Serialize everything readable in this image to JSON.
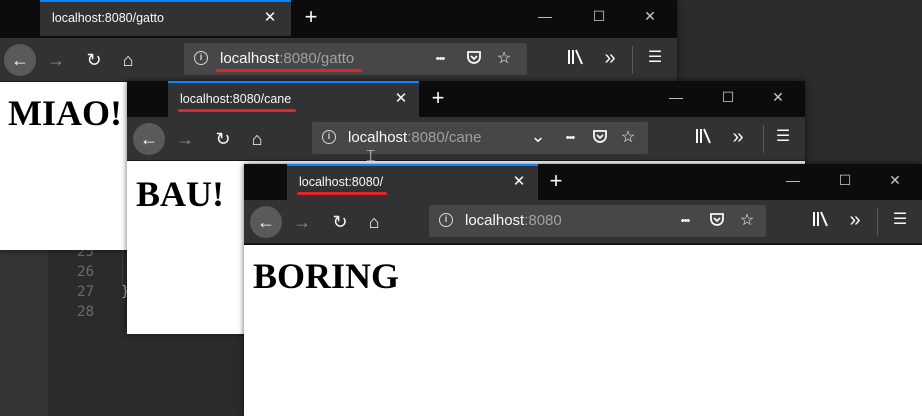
{
  "editor": {
    "line_numbers": [
      "25",
      "26",
      "27",
      "28"
    ],
    "code_line_27": "}"
  },
  "windows": {
    "gatto": {
      "tab_title": "localhost:8080/gatto",
      "url_host": "localhost",
      "url_path": ":8080/gatto",
      "heading": "MIAO!",
      "window_controls": [
        "minimize-icon",
        "maximize-icon",
        "close-icon"
      ]
    },
    "cane": {
      "tab_title": "localhost:8080/cane",
      "url_host": "localhost",
      "url_path": ":8080/cane",
      "heading": "BAU!",
      "window_controls": [
        "minimize-icon",
        "maximize-icon",
        "close-icon"
      ]
    },
    "root": {
      "tab_title": "localhost:8080/",
      "url_host": "localhost",
      "url_path": ":8080",
      "heading": "BORING",
      "window_controls": [
        "minimize-icon",
        "maximize-icon",
        "close-icon"
      ]
    }
  },
  "icons": {
    "back": "←",
    "forward": "→",
    "reload": "↻",
    "home": "⌂",
    "info": "i",
    "more": "•••",
    "pocket": "pocket-icon",
    "star": "☆",
    "dropdown": "⌄",
    "library": "library-icon",
    "overflow": "»",
    "menu": "☰",
    "tab_close": "✕",
    "new_tab": "+",
    "minimize": "—",
    "maximize": "☐",
    "close": "✕"
  },
  "colors": {
    "accent": "#0a84ff",
    "annotation_red": "#e0262b",
    "toolbar": "#323234",
    "titlebar": "#0c0c0d"
  }
}
